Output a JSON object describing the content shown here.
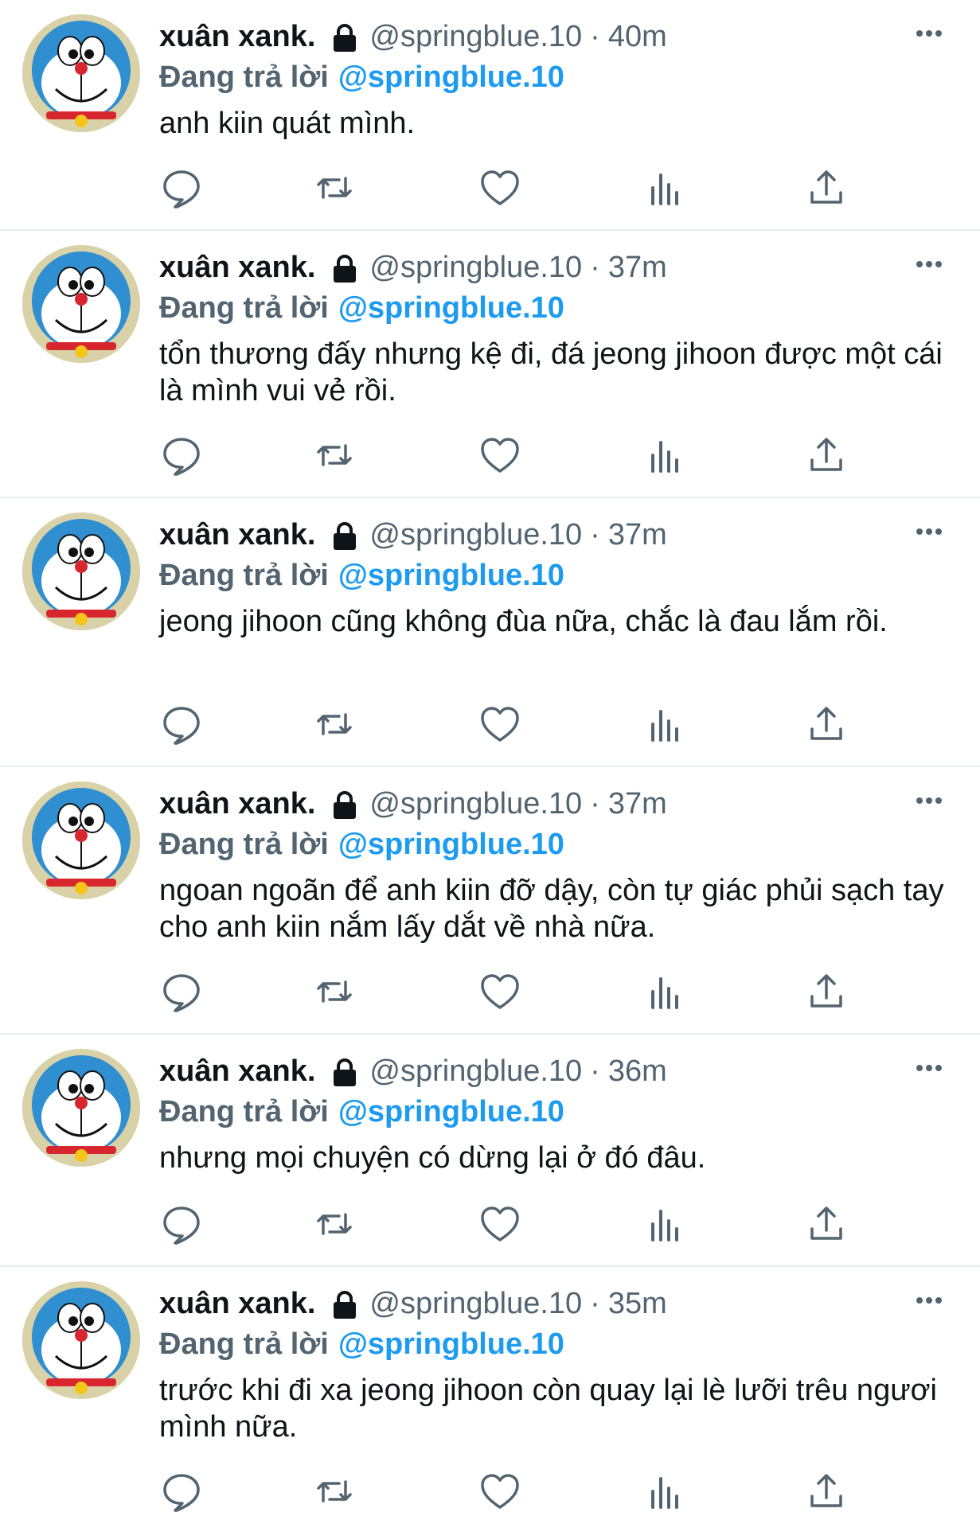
{
  "feed": {
    "reply_prefix": "Đang trả lời",
    "tweets": [
      {
        "name": "xuân xank.",
        "handle": "@springblue.10",
        "time": "40m",
        "reply_to": "@springblue.10",
        "text": "anh kiin quát mình."
      },
      {
        "name": "xuân xank.",
        "handle": "@springblue.10",
        "time": "37m",
        "reply_to": "@springblue.10",
        "text": "tổn thương đấy nhưng kệ đi, đá jeong jihoon được một cái là mình vui vẻ rồi."
      },
      {
        "name": "xuân xank.",
        "handle": "@springblue.10",
        "time": "37m",
        "reply_to": "@springblue.10",
        "text": "jeong jihoon cũng không đùa nữa, chắc là đau lắm rồi."
      },
      {
        "name": "xuân xank.",
        "handle": "@springblue.10",
        "time": "37m",
        "reply_to": "@springblue.10",
        "text": "ngoan ngoãn để anh kiin đỡ dậy, còn tự giác phủi sạch tay cho anh kiin nắm lấy dắt về nhà nữa."
      },
      {
        "name": "xuân xank.",
        "handle": "@springblue.10",
        "time": "36m",
        "reply_to": "@springblue.10",
        "text": "nhưng mọi chuyện có dừng lại ở đó đâu."
      },
      {
        "name": "xuân xank.",
        "handle": "@springblue.10",
        "time": "35m",
        "reply_to": "@springblue.10",
        "text": "trước khi đi xa jeong jihoon còn quay lại lè lưỡi trêu ngươi mình nữa."
      }
    ]
  },
  "icons": {
    "lock": "lock-icon",
    "more": "more-icon",
    "reply": "reply-icon",
    "retweet": "retweet-icon",
    "like": "like-icon",
    "views": "views-icon",
    "share": "share-icon"
  },
  "colors": {
    "link": "#1d9bf0",
    "secondary": "#536471",
    "text": "#0f1419",
    "divider": "#e6ecf0"
  }
}
